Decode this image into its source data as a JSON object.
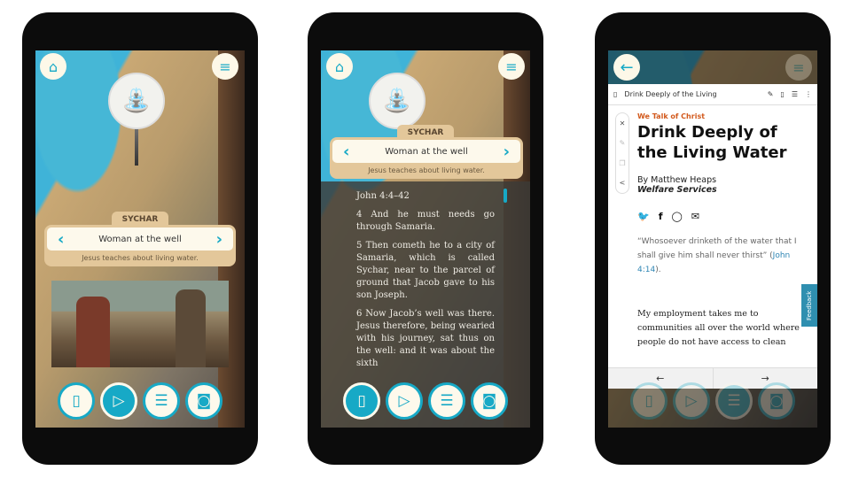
{
  "colors": {
    "accent": "#17a9c6",
    "card": "#e3c79a",
    "kicker": "#d2591c"
  },
  "location": {
    "place": "SYCHAR",
    "story": "Woman at the well",
    "summary": "Jesus teaches about living water."
  },
  "bottom_bar": [
    {
      "icon": "book-icon"
    },
    {
      "icon": "play-icon"
    },
    {
      "icon": "document-icon"
    },
    {
      "icon": "camera-icon"
    }
  ],
  "icons": {
    "home": "⌂",
    "menu": "≡",
    "back": "←",
    "prev": "‹",
    "next": "›",
    "book": "▯",
    "play": "▷",
    "doc": "☰",
    "camera": "◙"
  },
  "scripture": {
    "reference": "John 4:4–42",
    "verses": [
      "4 And he must needs go through Samaria.",
      "5 Then cometh he to a city of Samaria, which is called Sychar, near to the parcel of ground that Jacob gave to his son Joseph.",
      "6 Now Jacob’s well was there. Jesus therefore, being wearied with his journey, sat thus on the well: and it was about the sixth"
    ]
  },
  "article": {
    "toolbar_title": "Drink Deeply of the Living",
    "kicker": "We Talk of Christ",
    "title": "Drink Deeply of the Living Water",
    "author": "By Matthew Heaps",
    "department": "Welfare Services",
    "quote": "“Whosoever drinketh of the water that I shall give him shall never thirst” (",
    "quote_ref": "John 4:14",
    "quote_end": ").",
    "body": "My employment takes me to communities all over the world where people do not have access to clean",
    "feedback": "Feedback"
  }
}
